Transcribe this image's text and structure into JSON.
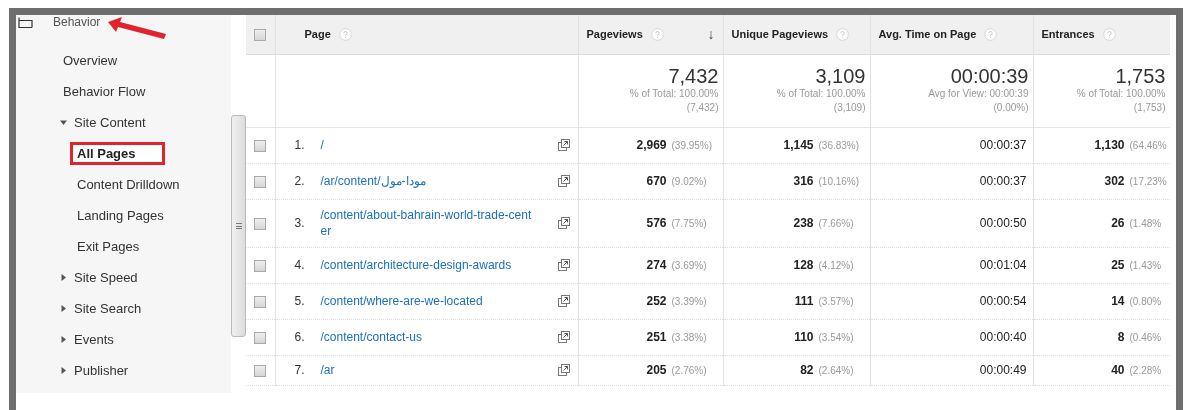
{
  "sidebar": {
    "section": {
      "label": "Behavior",
      "annotated": true
    },
    "items": [
      {
        "label": "Overview",
        "kind": "link",
        "selected": false
      },
      {
        "label": "Behavior Flow",
        "kind": "link",
        "selected": false
      },
      {
        "label": "Site Content",
        "kind": "group",
        "expanded": true,
        "children": [
          {
            "label": "All Pages",
            "kind": "link",
            "selected": true
          },
          {
            "label": "Content Drilldown",
            "kind": "link",
            "selected": false
          },
          {
            "label": "Landing Pages",
            "kind": "link",
            "selected": false
          },
          {
            "label": "Exit Pages",
            "kind": "link",
            "selected": false
          }
        ]
      },
      {
        "label": "Site Speed",
        "kind": "group",
        "expanded": false
      },
      {
        "label": "Site Search",
        "kind": "group",
        "expanded": false
      },
      {
        "label": "Events",
        "kind": "group",
        "expanded": false
      },
      {
        "label": "Publisher",
        "kind": "group",
        "expanded": false
      }
    ]
  },
  "table": {
    "select_all": {
      "checked": false
    },
    "columns": [
      {
        "label": "Page",
        "kind": "text"
      },
      {
        "label": "Pageviews",
        "kind": "metric",
        "sort_glyph": "↓",
        "total": {
          "value": "7,432",
          "note": "% of Total: 100.00%",
          "sub": "(7,432)"
        }
      },
      {
        "label": "Unique Pageviews",
        "kind": "metric",
        "total": {
          "value": "3,109",
          "note": "% of Total: 100.00%",
          "sub": "(3,109)"
        }
      },
      {
        "label": "Avg. Time on Page",
        "kind": "metric",
        "total": {
          "value": "00:00:39",
          "note": "Avg for View: 00:00:39",
          "sub": "(0.00%)"
        }
      },
      {
        "label": "Entrances",
        "kind": "metric",
        "total": {
          "value": "1,753",
          "note": "% of Total: 100.00%",
          "sub": "(1,753)"
        }
      }
    ],
    "rows": [
      {
        "checked": false,
        "cells": [
          {
            "index": "1.",
            "page": "/"
          },
          {
            "value": "2,969",
            "pct": "(39.95%)"
          },
          {
            "value": "1,145",
            "pct": "(36.83%)"
          },
          {
            "value": "00:00:37"
          },
          {
            "value": "1,130",
            "pct": "(64.46%"
          }
        ]
      },
      {
        "checked": false,
        "cells": [
          {
            "index": "2.",
            "page": "/ar/content/مودا-مول"
          },
          {
            "value": "670",
            "pct": "(9.02%)"
          },
          {
            "value": "316",
            "pct": "(10.16%)"
          },
          {
            "value": "00:00:37"
          },
          {
            "value": "302",
            "pct": "(17.23%"
          }
        ]
      },
      {
        "checked": false,
        "cells": [
          {
            "index": "3.",
            "page": "/content/about-bahrain-world-trade-center"
          },
          {
            "value": "576",
            "pct": "(7.75%)"
          },
          {
            "value": "238",
            "pct": "(7.66%)"
          },
          {
            "value": "00:00:50"
          },
          {
            "value": "26",
            "pct": "(1.48%"
          }
        ]
      },
      {
        "checked": false,
        "cells": [
          {
            "index": "4.",
            "page": "/content/architecture-design-awards"
          },
          {
            "value": "274",
            "pct": "(3.69%)"
          },
          {
            "value": "128",
            "pct": "(4.12%)"
          },
          {
            "value": "00:01:04"
          },
          {
            "value": "25",
            "pct": "(1.43%"
          }
        ]
      },
      {
        "checked": false,
        "cells": [
          {
            "index": "5.",
            "page": "/content/where-are-we-located"
          },
          {
            "value": "252",
            "pct": "(3.39%)"
          },
          {
            "value": "111",
            "pct": "(3.57%)"
          },
          {
            "value": "00:00:54"
          },
          {
            "value": "14",
            "pct": "(0.80%"
          }
        ]
      },
      {
        "checked": false,
        "cells": [
          {
            "index": "6.",
            "page": "/content/contact-us"
          },
          {
            "value": "251",
            "pct": "(3.38%)"
          },
          {
            "value": "110",
            "pct": "(3.54%)"
          },
          {
            "value": "00:00:40"
          },
          {
            "value": "8",
            "pct": "(0.46%"
          }
        ]
      },
      {
        "checked": false,
        "cells": [
          {
            "index": "7.",
            "page": "/ar"
          },
          {
            "value": "205",
            "pct": "(2.76%)"
          },
          {
            "value": "82",
            "pct": "(2.64%)"
          },
          {
            "value": "00:00:49"
          },
          {
            "value": "40",
            "pct": "(2.28%"
          }
        ]
      }
    ]
  }
}
